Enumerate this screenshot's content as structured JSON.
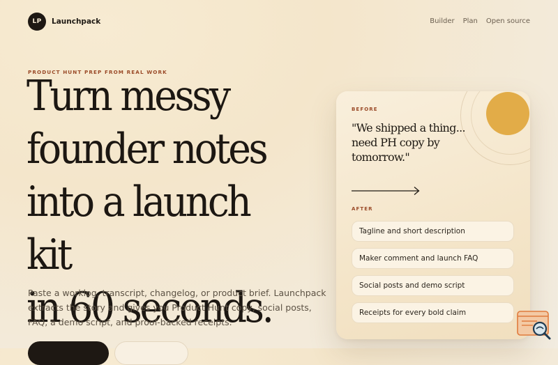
{
  "brand": {
    "initials": "LP",
    "name": "Launchpack"
  },
  "nav": {
    "items": [
      "Builder",
      "Plan",
      "Open source"
    ]
  },
  "hero": {
    "eyebrow": "PRODUCT HUNT PREP FROM REAL WORK",
    "headline_lines": [
      "Turn messy",
      "founder notes",
      "into a launch kit",
      "in 60 seconds."
    ],
    "subtitle": "Paste a worklog, transcript, changelog, or product brief. Launchpack extracts the story and gives you Product Hunt copy, social posts, FAQ, a demo script, and proof-backed receipts."
  },
  "card": {
    "before_label": "BEFORE",
    "quote": "\"We shipped a thing... need PH copy by tomorrow.\"",
    "after_label": "AFTER",
    "items": [
      "Tagline and short description",
      "Maker comment and launch FAQ",
      "Social posts and demo script",
      "Receipts for every bold claim"
    ]
  },
  "colors": {
    "accent": "#9a4a28",
    "sun": "#e2ac48",
    "dark": "#1e1813",
    "background": "#f4e6cb"
  },
  "icons": {
    "arrow": "right-arrow-icon",
    "corner": "search-document-icon"
  }
}
